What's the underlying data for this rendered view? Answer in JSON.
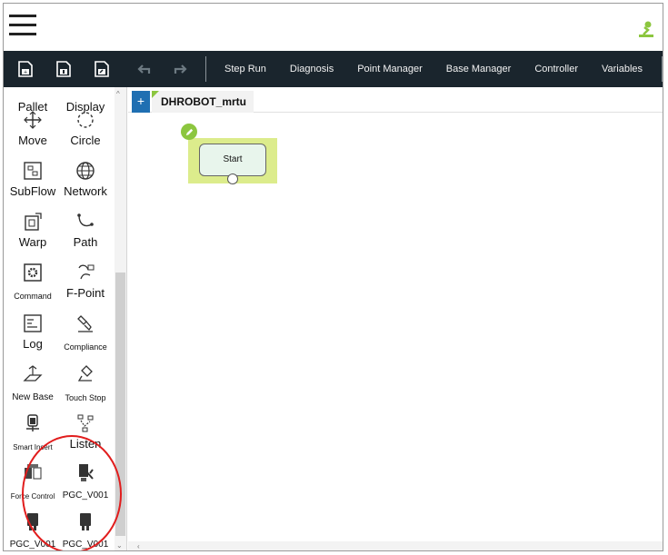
{
  "toolbar": {
    "buttons": [
      "Step Run",
      "Diagnosis",
      "Point Manager",
      "Base Manager",
      "Controller",
      "Variables"
    ]
  },
  "sidebar": {
    "items": [
      {
        "label": "Pallet",
        "icon": "pallet-icon"
      },
      {
        "label": "Display",
        "icon": "display-icon"
      },
      {
        "label": "Move",
        "icon": "move-icon"
      },
      {
        "label": "Circle",
        "icon": "circle-icon"
      },
      {
        "label": "SubFlow",
        "icon": "subflow-icon"
      },
      {
        "label": "Network",
        "icon": "network-icon"
      },
      {
        "label": "Warp",
        "icon": "warp-icon"
      },
      {
        "label": "Path",
        "icon": "path-icon"
      },
      {
        "label": "Command",
        "icon": "command-icon"
      },
      {
        "label": "F-Point",
        "icon": "f-point-icon"
      },
      {
        "label": "Log",
        "icon": "log-icon"
      },
      {
        "label": "Compliance",
        "icon": "compliance-icon"
      },
      {
        "label": "New Base",
        "icon": "new-base-icon"
      },
      {
        "label": "Touch Stop",
        "icon": "touch-stop-icon"
      },
      {
        "label": "Smart Insert",
        "icon": "smart-insert-icon"
      },
      {
        "label": "Listen",
        "icon": "listen-icon"
      },
      {
        "label": "Force Control",
        "icon": "force-control-icon"
      },
      {
        "label": "PGC_V001",
        "icon": "gripper-icon"
      },
      {
        "label": "PGC_V001",
        "icon": "gripper-icon"
      },
      {
        "label": "PGC_V001",
        "icon": "gripper-icon"
      }
    ]
  },
  "canvas": {
    "tab_add": "+",
    "tab_title": "DHROBOT_mrtu",
    "start_node_label": "Start"
  },
  "colors": {
    "toolbar_bg": "#1a252d",
    "accent_green": "#8cc63f",
    "tab_add_blue": "#1f6fb2",
    "highlight_red": "#e11d1d"
  }
}
